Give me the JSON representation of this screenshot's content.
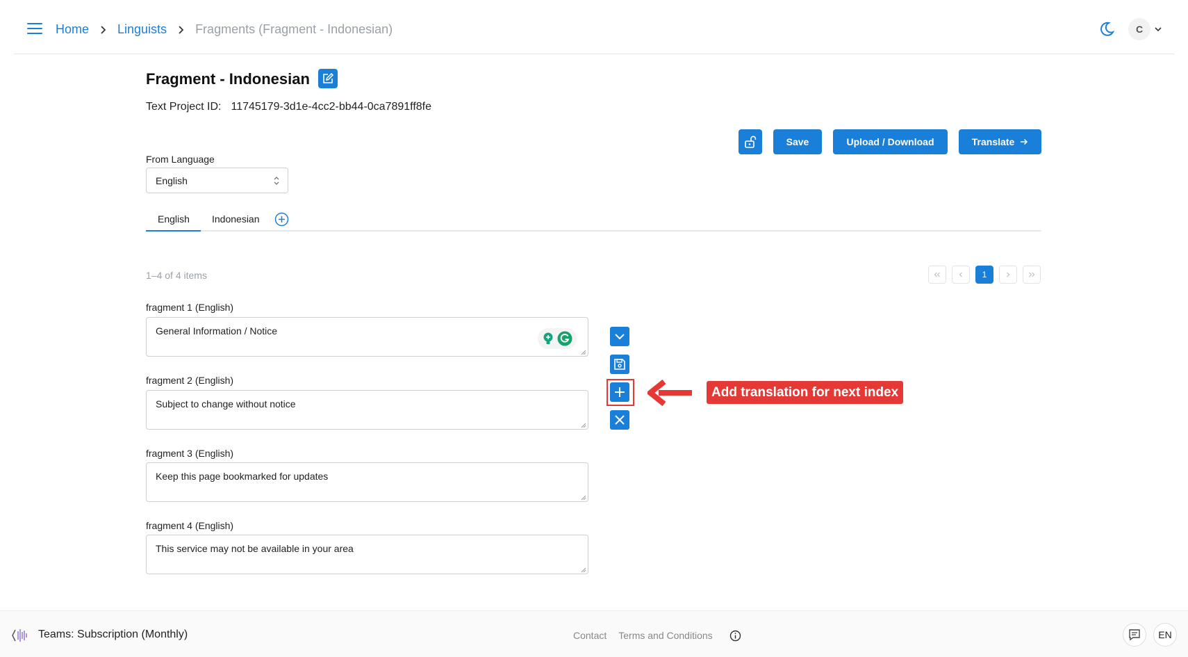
{
  "header": {
    "breadcrumbs": [
      "Home",
      "Linguists"
    ],
    "current": "Fragments (Fragment - Indonesian)",
    "user_initial": "C"
  },
  "page": {
    "title": "Fragment - Indonesian",
    "project_id_label": "Text Project ID:",
    "project_id": "11745179-3d1e-4cc2-bb44-0ca7891ff8fe"
  },
  "toolbar": {
    "save": "Save",
    "upload_download": "Upload / Download",
    "translate": "Translate"
  },
  "from_language": {
    "label": "From Language",
    "value": "English"
  },
  "tabs": [
    "English",
    "Indonesian"
  ],
  "pagination": {
    "summary": "1–4 of 4 items",
    "current_page": "1"
  },
  "fragments": [
    {
      "label": "fragment 1 (English)",
      "text": "General Information / Notice"
    },
    {
      "label": "fragment 2 (English)",
      "text": "Subject to change without notice"
    },
    {
      "label": "fragment 3 (English)",
      "text": "Keep this page bookmarked for updates"
    },
    {
      "label": "fragment 4 (English)",
      "text": "This service may not be available in your area"
    }
  ],
  "annotation": "Add translation for next index",
  "footer": {
    "team": "Teams: Subscription (Monthly)",
    "links": [
      "Contact",
      "Terms and Conditions"
    ],
    "lang": "EN"
  },
  "colors": {
    "accent": "#1a7fd8",
    "annotation": "#e53935"
  }
}
